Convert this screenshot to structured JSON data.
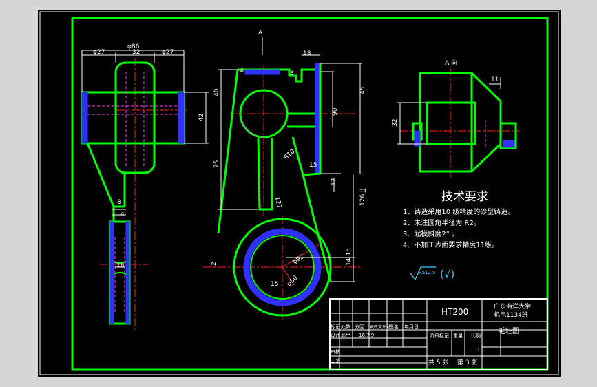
{
  "view_labels": {
    "view_a_top": "A",
    "view_a_right": "A 向"
  },
  "dims_left": {
    "d86": "φ86",
    "d27a": "φ27",
    "d32": "32",
    "d27b": "φ27",
    "d42": "42",
    "d8": "8",
    "d4": "4",
    "d16": "16"
  },
  "dims_center": {
    "d18": "18",
    "d4": "4",
    "d3": "3",
    "d40": "40",
    "d45": "45",
    "d90": "90",
    "d75": "75",
    "r10": "R10",
    "d15": "15",
    "d12": "12",
    "d127": "127",
    "d126": "126 JJ",
    "d2": "2",
    "phi92": "φ92",
    "phi50": "φ50",
    "d15b": "15",
    "d1415": "14.15"
  },
  "dims_right": {
    "d32": "32",
    "d11": "11"
  },
  "tech_req": {
    "title": "技术要求",
    "item1": "1、铸造采用10 级精度的砂型铸造。",
    "item2": "2、未注圆角半径为 R2。",
    "item3": "3、起模斜度2°  。",
    "item4": "4、不加工表面要求精度11级。"
  },
  "roughness": {
    "symbol_text": "Ra12.5",
    "check": "(√)"
  },
  "title_block": {
    "material": "HT200",
    "school_line1": "广东海洋大学",
    "school_line2": "机电1134班",
    "drawing_name": "毛坯图",
    "col1": "标记",
    "col2": "处数",
    "col3": "分区",
    "col4": "更改文件号",
    "col5": "签名",
    "col6": "年月日",
    "design": "设计",
    "designer": "郭**",
    "date": "16.7.9",
    "stage": "阶段标记",
    "weight": "重量",
    "scale_label": "比例",
    "scale": "1:1",
    "review": "审核",
    "craft": "工艺",
    "sheets_total": "共 5 张",
    "sheet_no": "第 3 张"
  },
  "colors": {
    "outline": "#00ff00",
    "dim": "#ffffff",
    "center": "#ff2020",
    "hatch": "#3030ff",
    "hidden": "#ff40ff",
    "frame": "#00ff00"
  }
}
